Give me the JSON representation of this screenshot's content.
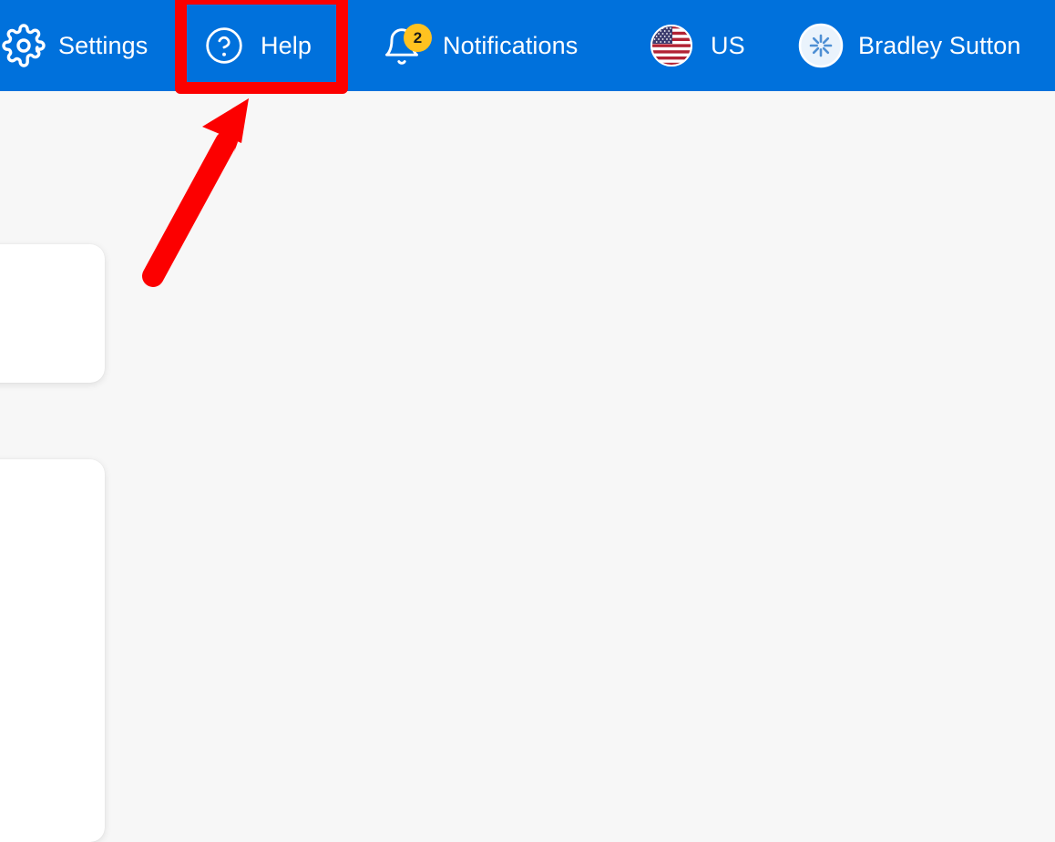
{
  "topbar": {
    "background_color": "#0071DC",
    "text_color": "#FFFFFF",
    "items": [
      {
        "id": "settings",
        "label": "Settings",
        "icon": "gear-icon"
      },
      {
        "id": "help",
        "label": "Help",
        "icon": "question-circle-icon"
      },
      {
        "id": "notifications",
        "label": "Notifications",
        "icon": "bell-icon",
        "badge": "2",
        "badge_color": "#FFC220"
      },
      {
        "id": "locale",
        "label": "US",
        "icon": "us-flag-icon"
      },
      {
        "id": "account",
        "label": "Bradley Sutton",
        "icon": "spark-avatar-icon"
      }
    ]
  },
  "page": {
    "background_color": "#F7F7F7",
    "cards": [
      {
        "id": "card-top",
        "background_color": "#FFFFFF"
      },
      {
        "id": "card-bottom",
        "background_color": "#FFFFFF",
        "panel_color": "#E1F4FD",
        "dot_color": "#FFB81C"
      }
    ]
  },
  "annotation": {
    "color": "#FC0000",
    "highlight_target": "Help",
    "arrow": "points-up-right-to-help-button"
  }
}
